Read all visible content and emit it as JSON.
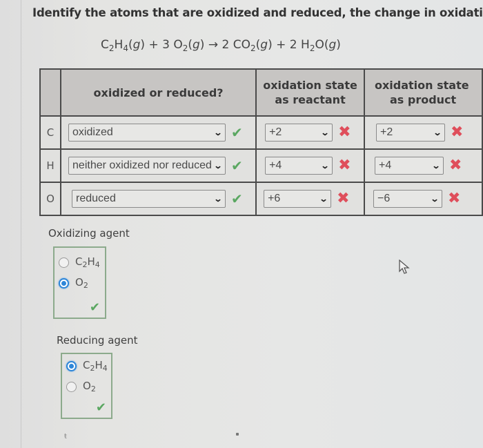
{
  "question": {
    "text": "Identify the atoms that are oxidized and reduced, the change in oxidation state"
  },
  "equation": {
    "reactant1": {
      "formula": [
        "C",
        "2",
        "H",
        "4"
      ],
      "state": "(g)"
    },
    "plus1": "+",
    "coef2": "3",
    "reactant2": {
      "formula": [
        "O",
        "2"
      ],
      "state": "(g)"
    },
    "arrow": "→",
    "coef3": "2",
    "product1": {
      "formula": [
        "CO",
        "2"
      ],
      "state": "(g)"
    },
    "plus2": "+",
    "coef4": "2",
    "product2": {
      "formula": [
        "H",
        "2",
        "O"
      ],
      "state": "(g)"
    }
  },
  "table": {
    "headers": {
      "atom": "",
      "oxidized_or_reduced": "oxidized or reduced?",
      "reactant_line1": "oxidation state",
      "reactant_line2": "as reactant",
      "product_line1": "oxidation state",
      "product_line2": "as product"
    },
    "rows": [
      {
        "atom": "C",
        "status": "oxidized",
        "status_feedback": "correct",
        "reactant_state": "+2",
        "reactant_feedback": "incorrect",
        "product_state": "+2",
        "product_feedback": "incorrect"
      },
      {
        "atom": "H",
        "status": "neither oxidized nor reduced",
        "status_feedback": "correct",
        "reactant_state": "+4",
        "reactant_feedback": "incorrect",
        "product_state": "+4",
        "product_feedback": "incorrect"
      },
      {
        "atom": "O",
        "status": "reduced",
        "status_feedback": "correct",
        "reactant_state": "+6",
        "reactant_feedback": "incorrect",
        "product_state": "−6",
        "product_feedback": "incorrect"
      }
    ]
  },
  "icons": {
    "chevron": "⌄",
    "check": "✔",
    "cross": "✖"
  },
  "oxidizing_agent": {
    "label": "Oxidizing agent",
    "options": [
      {
        "main": "C",
        "sub1": "2",
        "main2": "H",
        "sub2": "4",
        "selected": false
      },
      {
        "main": "O",
        "sub1": "2",
        "main2": "",
        "sub2": "",
        "selected": true
      }
    ],
    "feedback": "correct"
  },
  "reducing_agent": {
    "label": "Reducing agent",
    "options": [
      {
        "main": "C",
        "sub1": "2",
        "main2": "H",
        "sub2": "4",
        "selected": true
      },
      {
        "main": "O",
        "sub1": "2",
        "main2": "",
        "sub2": "",
        "selected": false
      }
    ],
    "feedback": "correct"
  },
  "colors": {
    "correct": "#5aa761",
    "incorrect": "#df4e5b",
    "radio_selected": "#2e86d8",
    "header_bg": "#c7c5c3"
  },
  "footer": {
    "small_glyph": "ŧ"
  }
}
